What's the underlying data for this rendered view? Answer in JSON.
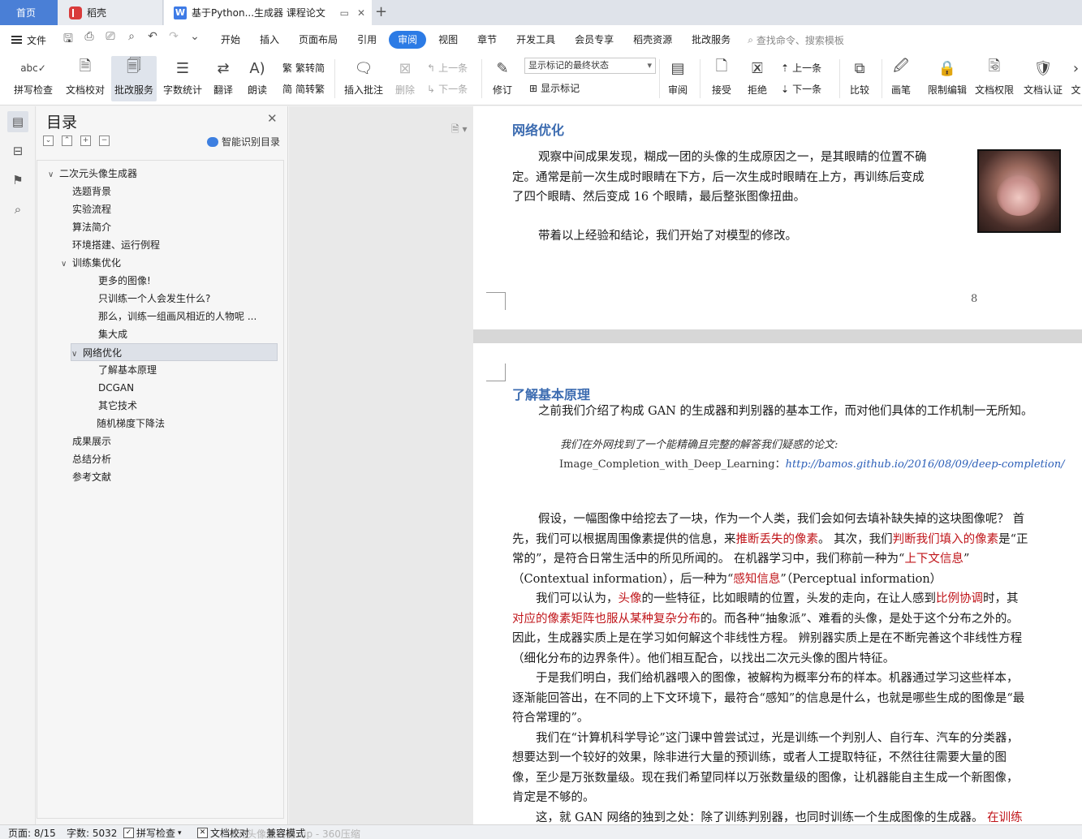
{
  "tabs": {
    "home": "首页",
    "daoke": "稻壳",
    "doc": "基于Python...生成器 课程论文",
    "add": "+"
  },
  "menu": {
    "file": "文件",
    "items": [
      "开始",
      "插入",
      "页面布局",
      "引用",
      "审阅",
      "视图",
      "章节",
      "开发工具",
      "会员专享",
      "稻壳资源",
      "批改服务"
    ],
    "active_index": 4,
    "search": "查找命令、搜索模板"
  },
  "ribbon": {
    "spell_check": "拼写检查",
    "doc_proof": "文档校对",
    "review_service": "批改服务",
    "word_count": "字数统计",
    "translate": "翻译",
    "read_aloud": "朗读",
    "trad_to_simp": "繁转简",
    "simp_to_trad": "简转繁",
    "insert_comment": "插入批注",
    "delete": "删除",
    "prev": "上一条",
    "next": "下一条",
    "track": "修订",
    "markup_state": "显示标记的最终状态",
    "show_markup": "显示标记",
    "review": "审阅",
    "accept": "接受",
    "reject": "拒绝",
    "prev2": "上一条",
    "next2": "下一条",
    "compare": "比较",
    "pen": "画笔",
    "restrict": "限制编辑",
    "doc_perm": "文档权限",
    "doc_cert": "文档认证",
    "more": "文"
  },
  "toc": {
    "title": "目录",
    "smart": "智能识别目录",
    "items": [
      {
        "label": "二次元头像生成器",
        "level": 0,
        "caret": "∨"
      },
      {
        "label": "选题背景",
        "level": 1,
        "caret": ""
      },
      {
        "label": "实验流程",
        "level": 1,
        "caret": ""
      },
      {
        "label": "算法简介",
        "level": 1,
        "caret": ""
      },
      {
        "label": "环境搭建、运行例程",
        "level": 1,
        "caret": ""
      },
      {
        "label": "训练集优化",
        "level": 1,
        "caret": "∨"
      },
      {
        "label": "更多的图像!",
        "level": 2,
        "caret": ""
      },
      {
        "label": "只训练一个人会发生什么?",
        "level": 2,
        "caret": ""
      },
      {
        "label": "那么，训练一组画风相近的人物呢 ...",
        "level": 2,
        "caret": ""
      },
      {
        "label": "集大成",
        "level": 2,
        "caret": ""
      },
      {
        "label": "网络优化",
        "level": 1,
        "caret": "∨",
        "selected": true
      },
      {
        "label": "了解基本原理",
        "level": 2,
        "caret": ""
      },
      {
        "label": "DCGAN",
        "level": 2,
        "caret": ""
      },
      {
        "label": "其它技术",
        "level": 2,
        "caret": ""
      },
      {
        "label": "随机梯度下降法",
        "level": 1.5,
        "caret": ""
      },
      {
        "label": "成果展示",
        "level": 1,
        "caret": ""
      },
      {
        "label": "总结分析",
        "level": 1,
        "caret": ""
      },
      {
        "label": "参考文献",
        "level": 1,
        "caret": ""
      }
    ]
  },
  "page1": {
    "heading": "网络优化",
    "p1": [
      "观察中间成果发现，糊成一团的头像的生成原因之一，是其眼睛的位置不确",
      "定。通常是前一次生成时眼睛在下方，后一次生成时眼睛在上方，再训练后变成",
      "了四个眼睛、然后变成 16 个眼睛，最后整张图像扭曲。"
    ],
    "p2": "带着以上经验和结论，我们开始了对模型的修改。",
    "page_number": "8"
  },
  "page2": {
    "heading": "了解基本原理",
    "intro": "之前我们介绍了构成 GAN 的生成器和判别器的基本工作，而对他们具体的工作机制一无所知。",
    "quote1": "我们在外网找到了一个能精确且完整的解答我们疑惑的论文:",
    "quote2_label": "Image_Completion_with_Deep_Learning：",
    "quote2_link": "http://bamos.github.io/2016/08/09/deep-completion/",
    "body": [
      [
        {
          "t": "假设，一幅图像中给挖去了一块，作为一个人类，我们会如何去填补缺失掉的这块图像呢？ 首"
        }
      ],
      [
        {
          "t": "先，我们可以根据周围像素提供的信息，来"
        },
        {
          "t": "推断丢失的像素",
          "r": true
        },
        {
          "t": "。 其次，我们"
        },
        {
          "t": "判断我们填入的像素",
          "r": true
        },
        {
          "t": "是“正"
        }
      ],
      [
        {
          "t": "常的”，是符合日常生活中的所见所闻的。 在机器学习中，我们称前一种为“"
        },
        {
          "t": "上下文信息",
          "r": true
        },
        {
          "t": "”"
        }
      ],
      [
        {
          "t": "（Contextual information），后一种为“"
        },
        {
          "t": "感知信息",
          "r": true
        },
        {
          "t": "”（Perceptual information）"
        }
      ],
      [
        {
          "t": "　　我们可以认为，"
        },
        {
          "t": "头像",
          "r": true
        },
        {
          "t": "的一些特征，比如眼睛的位置，头发的走向，在让人感到"
        },
        {
          "t": "比例协调",
          "r": true
        },
        {
          "t": "时，其"
        }
      ],
      [
        {
          "t": "对应的像素矩阵也服从某种复杂分布",
          "r": true
        },
        {
          "t": "的。而各种“抽象派”、难看的头像，是处于这个分布之外的。"
        }
      ],
      [
        {
          "t": "因此，生成器实质上是在学习如何解这个非线性方程。 辨别器实质上是在不断完善这个非线性方程"
        }
      ],
      [
        {
          "t": "（细化分布的边界条件）。他们相互配合，以找出二次元头像的图片特征。"
        }
      ],
      [
        {
          "t": "　　于是我们明白，我们给机器喂入的图像，被解构为概率分布的样本。机器通过学习这些样本，"
        }
      ],
      [
        {
          "t": "逐渐能回答出，在不同的上下文环境下，最符合“感知”的信息是什么，也就是哪些生成的图像是“最"
        }
      ],
      [
        {
          "t": "符合常理的”。"
        }
      ],
      [
        {
          "t": "　　我们在“计算机科学导论”这门课中曾尝试过，光是训练一个判别人、自行车、汽车的分类器，"
        }
      ],
      [
        {
          "t": "想要达到一个较好的效果，除非进行大量的预训练，或者人工提取特征，不然往往需要大量的图"
        }
      ],
      [
        {
          "t": "像，至少是万张数量级。现在我们希望同样以万张数量级的图像，让机器能自主生成一个新图像，"
        }
      ],
      [
        {
          "t": "肯定是不够的。"
        }
      ],
      [
        {
          "t": "　　这，就 GAN 网络的独到之处：除了训练判别器，也同时训练一个生成图像的生成器。 "
        },
        {
          "t": "在训练",
          "r": true
        }
      ]
    ]
  },
  "status": {
    "page": "页面: 8/15",
    "words": "字数: 5032",
    "spell": "拼写检查",
    "proof": "文档校对",
    "compat": "兼容模式",
    "ghost": "次元头像生成器.zip - 360压缩"
  },
  "colors": {
    "accent": "#2c7be5",
    "heading_blue": "#3b6bb0",
    "highlight_red": "#c0151a"
  }
}
